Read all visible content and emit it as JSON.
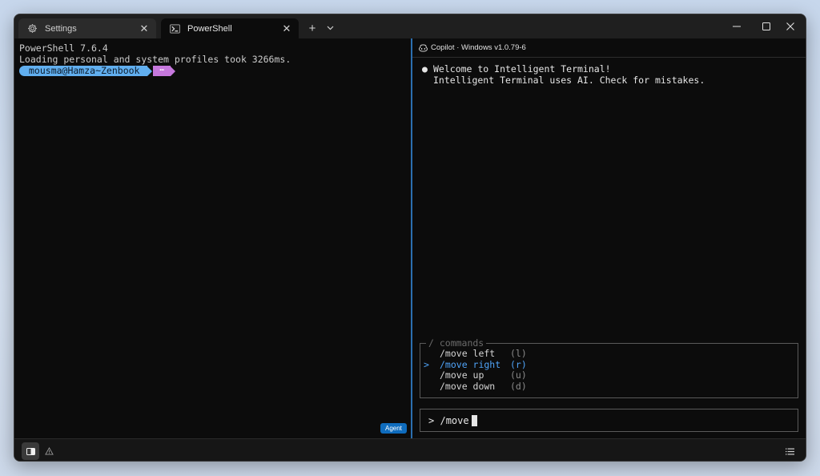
{
  "tabs": [
    {
      "label": "Settings",
      "icon": "gear-icon"
    },
    {
      "label": "PowerShell",
      "icon": "powershell-icon"
    }
  ],
  "new_tab_label": "+",
  "terminal": {
    "lines": [
      "PowerShell 7.6.4",
      "Loading personal and system profiles took 3266ms."
    ],
    "prompt_user": "mousma@Hamza~Zenbook",
    "prompt_segment2": "⋯",
    "agent_badge": "Agent"
  },
  "copilot": {
    "header": "Copilot · Windows v1.0.79-6",
    "welcome_line1": "Welcome to Intelligent Terminal!",
    "welcome_line2": "Intelligent Terminal uses AI. Check for mistakes.",
    "commands_legend": "/ commands",
    "commands": [
      {
        "name": "/move left",
        "key": "(l)",
        "selected": false
      },
      {
        "name": "/move right",
        "key": "(r)",
        "selected": true
      },
      {
        "name": "/move up",
        "key": "(u)",
        "selected": false
      },
      {
        "name": "/move down",
        "key": "(d)",
        "selected": false
      }
    ],
    "selector": ">",
    "input_prompt": ">",
    "input_value": "/move"
  },
  "colors": {
    "accent": "#4fa3f7",
    "prompt_blue": "#61afef",
    "prompt_purple": "#c678dd",
    "agent_badge": "#0f6cbd",
    "divider": "#2b6fb0"
  }
}
